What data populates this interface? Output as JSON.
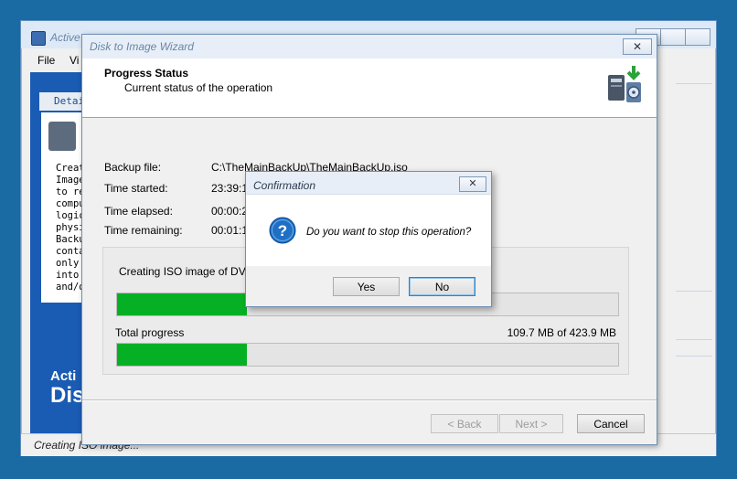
{
  "main_window": {
    "title": "Active",
    "menu": [
      "File",
      "Vi"
    ],
    "details_tab": "Detai",
    "description": "Creat\nImage\nto re\ncompu\nlogic\nphysi\nBacku\ncontai\nonly\ninto\nand/o",
    "brand_line1": "Acti",
    "brand_line2": "Dis",
    "status": "Creating ISO image..."
  },
  "wizard": {
    "title": "Disk to Image Wizard",
    "close_glyph": "✕",
    "header_title": "Progress Status",
    "header_subtitle": "Current status of the operation",
    "fields": {
      "backup_label": "Backup file:",
      "backup_value": "C:\\TheMainBackUp\\TheMainBackUp.iso",
      "started_label": "Time started:",
      "started_value": "23:39:1",
      "elapsed_label": "Time elapsed:",
      "elapsed_value": "00:00:2",
      "remaining_label": "Time remaining:",
      "remaining_value": "00:01:1"
    },
    "progress": {
      "current_label": "Creating ISO image of DVD_R",
      "current_fraction": 0.259,
      "total_label": "Total progress",
      "total_size": "109.7 MB of 423.9 MB",
      "total_fraction": 0.259
    },
    "buttons": {
      "back": "< Back",
      "next": "Next >",
      "cancel": "Cancel"
    }
  },
  "confirmation": {
    "title": "Confirmation",
    "close_glyph": "✕",
    "icon": "question-icon",
    "message": "Do you want to stop this operation?",
    "yes": "Yes",
    "no": "No"
  },
  "colors": {
    "desktop": "#1a6aa3",
    "progress_fill": "#06b025",
    "brand_panel": "#1a5bb3"
  }
}
